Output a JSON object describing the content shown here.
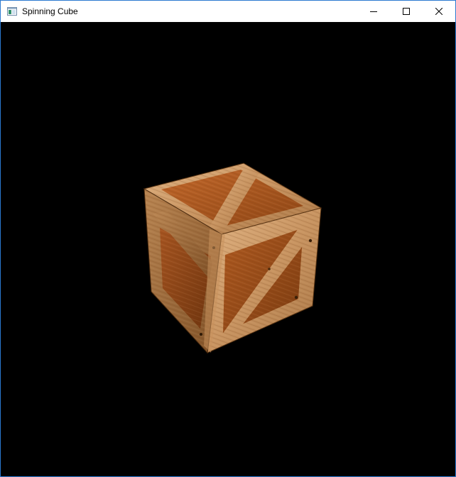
{
  "window": {
    "title": "Spinning Cube",
    "icons": {
      "app": "app-window-icon",
      "minimize": "minimize-icon",
      "maximize": "maximize-icon",
      "close": "close-icon"
    }
  },
  "viewport": {
    "background": "#000000",
    "object": "wooden-crate-cube"
  },
  "colors": {
    "frame_border": "#2b79d0",
    "titlebar_bg": "#ffffff",
    "plank_light": "#d4a271",
    "plank_dark": "#9a6433",
    "panel_mid": "#b25c22",
    "panel_dark": "#7c3a10"
  }
}
